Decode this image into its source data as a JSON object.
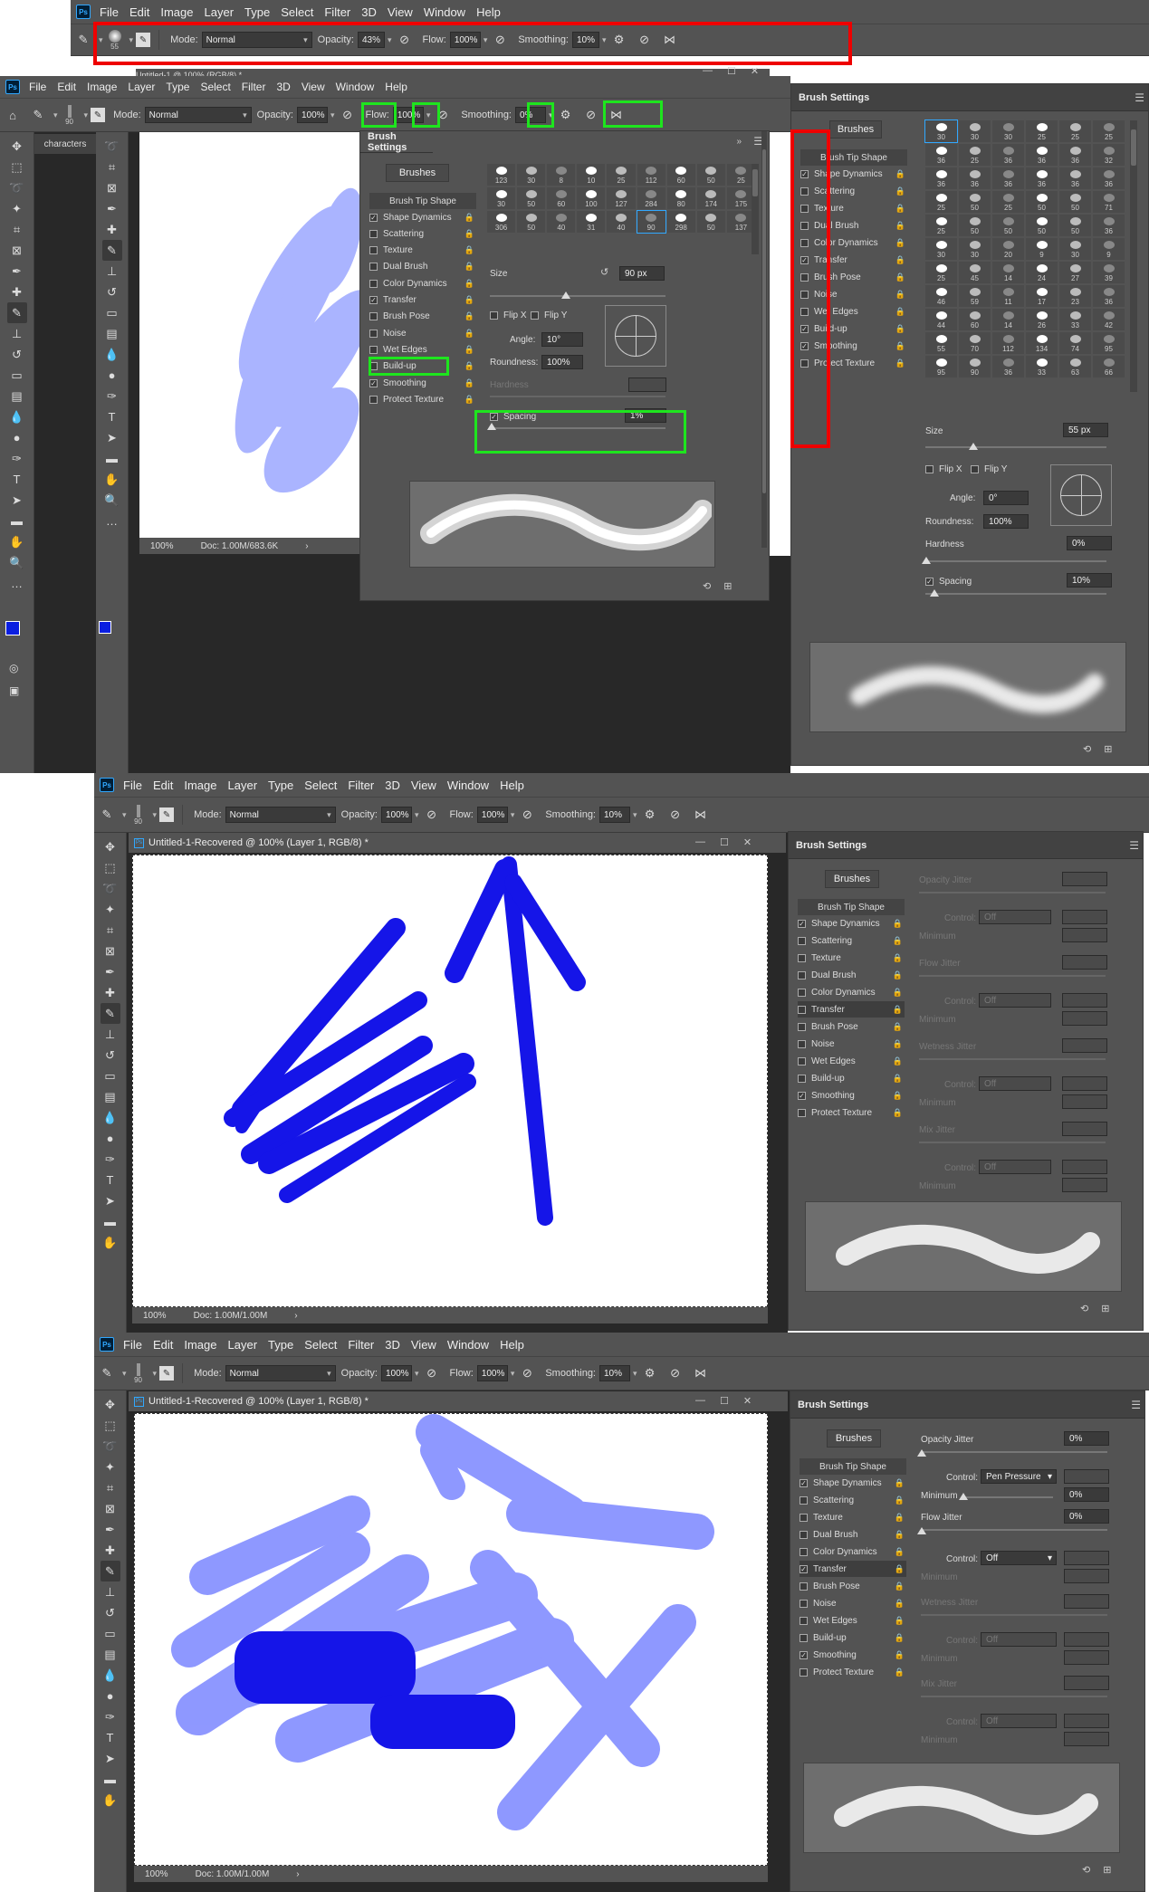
{
  "menu": {
    "ps": "Ps",
    "file": "File",
    "edit": "Edit",
    "image": "Image",
    "layer": "Layer",
    "type": "Type",
    "select": "Select",
    "filter": "Filter",
    "three_d": "3D",
    "view": "View",
    "window": "Window",
    "help": "Help"
  },
  "options": {
    "mode_label": "Mode:",
    "mode": "Normal",
    "opacity_label": "Opacity:",
    "flow_label": "Flow:",
    "smoothing_label": "Smoothing:",
    "s1": {
      "brush_size": "55",
      "opacity": "43%",
      "flow": "100%",
      "smoothing": "10%"
    },
    "s2": {
      "brush_size": "90",
      "opacity": "100%",
      "flow": "100%",
      "smoothing": "0%"
    },
    "s3": {
      "brush_size": "90",
      "opacity": "100%",
      "flow": "100%",
      "smoothing": "10%"
    },
    "s4": {
      "brush_size": "90",
      "opacity": "100%",
      "flow": "100%",
      "smoothing": "10%"
    }
  },
  "docs": {
    "s2_title": "Untitled-1 @ 100% (RGB/8) *",
    "s3_title": "Untitled-1-Recovered @ 100% (Layer 1, RGB/8) *",
    "s4_title": "Untitled-1-Recovered @ 100% (Layer 1, RGB/8) *",
    "zoom": "100%",
    "s2_doc": "Doc: 1.00M/683.6K",
    "s3_doc": "Doc: 1.00M/1.00M",
    "s4_doc": "Doc: 1.00M/1.00M",
    "side_tab": "characters"
  },
  "brush_panel": {
    "title": "Brush Settings",
    "brushes_btn": "Brushes",
    "tip_shape": "Brush Tip Shape",
    "options": [
      "Shape Dynamics",
      "Scattering",
      "Texture",
      "Dual Brush",
      "Color Dynamics",
      "Transfer",
      "Brush Pose",
      "Noise",
      "Wet Edges",
      "Build-up",
      "Smoothing",
      "Protect Texture"
    ],
    "size_label": "Size",
    "flip_x": "Flip X",
    "flip_y": "Flip Y",
    "angle_label": "Angle:",
    "roundness_label": "Roundness:",
    "hardness_label": "Hardness",
    "spacing_label": "Spacing",
    "s2": {
      "size": "90 px",
      "angle": "10°",
      "roundness": "100%",
      "spacing": "1%",
      "brush_nums": [
        "123",
        "30",
        "8",
        "10",
        "25",
        "112",
        "60",
        "50",
        "25",
        "30",
        "50",
        "60",
        "100",
        "127",
        "284",
        "80",
        "174",
        "175",
        "306",
        "50",
        "40",
        "31",
        "40",
        "90",
        "298",
        "50",
        "137"
      ]
    },
    "s1": {
      "size": "55 px",
      "angle": "0°",
      "roundness": "100%",
      "hardness": "0%",
      "spacing": "10%",
      "brush_nums": [
        "30",
        "30",
        "30",
        "25",
        "25",
        "25",
        "36",
        "25",
        "36",
        "36",
        "36",
        "32",
        "36",
        "36",
        "36",
        "36",
        "36",
        "36",
        "25",
        "50",
        "25",
        "50",
        "50",
        "71",
        "25",
        "50",
        "50",
        "50",
        "50",
        "36",
        "30",
        "30",
        "20",
        "9",
        "30",
        "9",
        "25",
        "45",
        "14",
        "24",
        "27",
        "39",
        "46",
        "59",
        "11",
        "17",
        "23",
        "36",
        "44",
        "60",
        "14",
        "26",
        "33",
        "42",
        "55",
        "70",
        "112",
        "134",
        "74",
        "95",
        "95",
        "90",
        "36",
        "33",
        "63",
        "66"
      ]
    },
    "transfer": {
      "opacity_jitter": "Opacity Jitter",
      "control": "Control:",
      "minimum": "Minimum",
      "flow_jitter": "Flow Jitter",
      "wetness_jitter": "Wetness Jitter",
      "mix_jitter": "Mix Jitter",
      "off": "Off",
      "pen_pressure": "Pen Pressure",
      "s4_opacity_jitter": "0%",
      "s4_minimum": "0%",
      "s4_flow_jitter": "0%"
    }
  },
  "colors": {
    "accent": "#31a8ff",
    "foreground": "#0a1ee0",
    "background": "#ffffff",
    "highlight_red": "#ee0000",
    "highlight_green": "#1ee51e",
    "panel": "#535353"
  }
}
